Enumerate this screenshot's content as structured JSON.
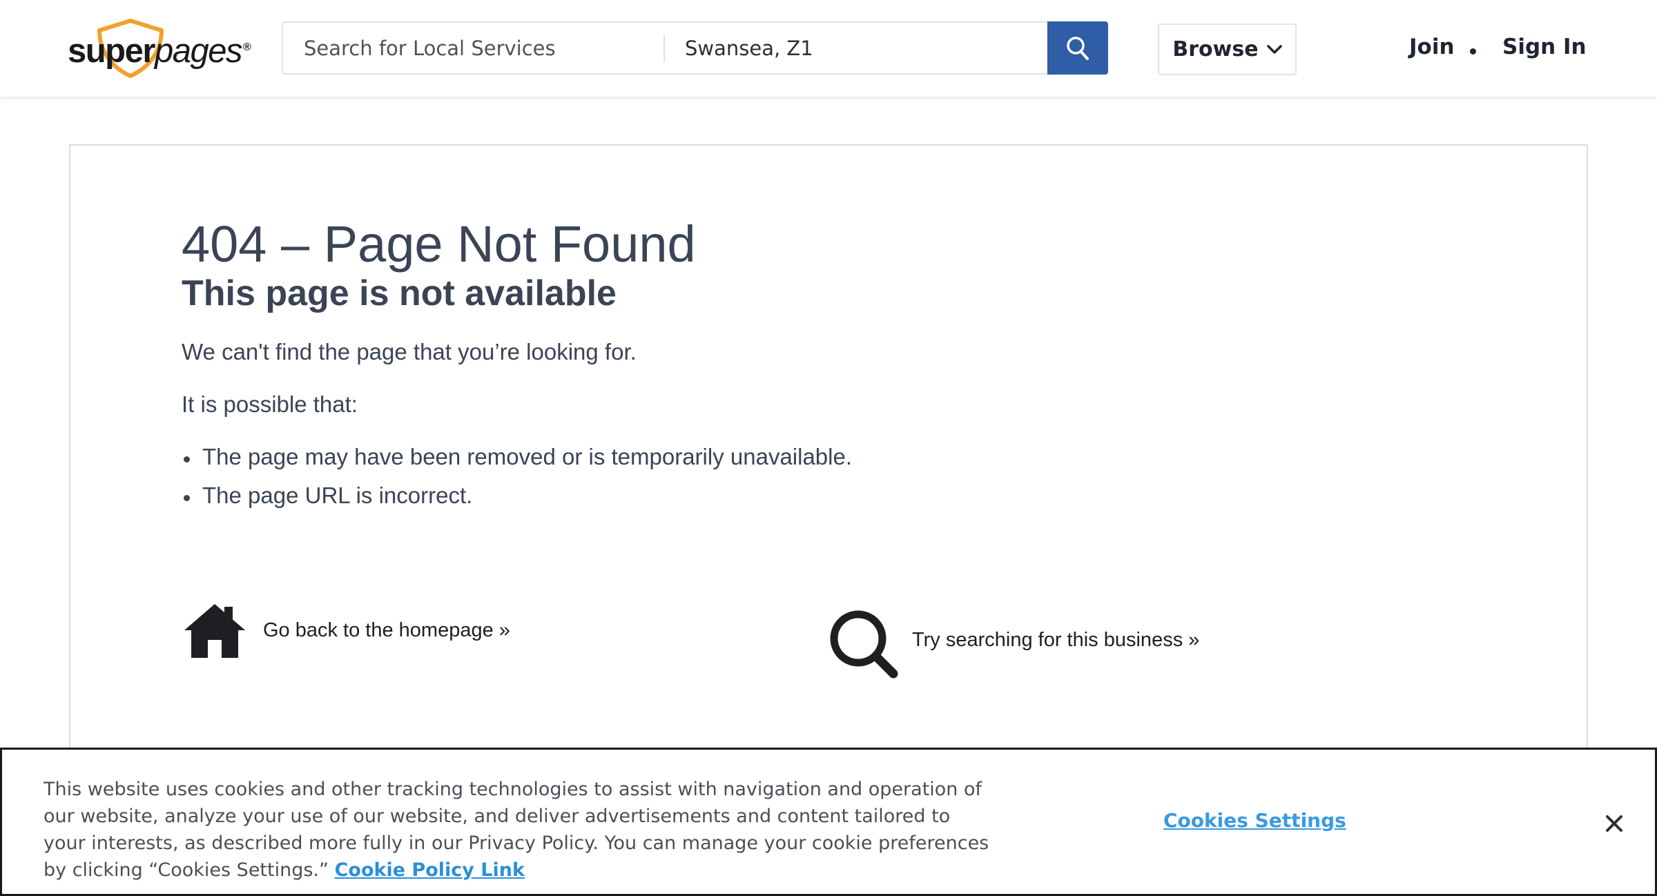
{
  "header": {
    "logo_text_bold": "super",
    "logo_text_light": "pages",
    "logo_reg": "®",
    "search": {
      "placeholder": "Search for Local Services",
      "value": ""
    },
    "location": {
      "value": "Swansea, Z1"
    },
    "browse_label": "Browse",
    "join_label": "Join",
    "signin_label": "Sign In"
  },
  "error": {
    "title": "404 – Page Not Found",
    "subtitle": "This page is not available",
    "message": "We can't find the page that you’re looking for.",
    "possible_intro": "It is possible that:",
    "reasons": [
      "The page may have been removed or is temporarily unavailable.",
      "The page URL is incorrect."
    ],
    "home_link": "Go back to the homepage »",
    "search_link": "Try searching for this business »"
  },
  "cookie_banner": {
    "text": "This website uses cookies and other tracking technologies to assist with navigation and operation of our website, analyze your use of our website, and deliver advertisements and content tailored to your interests, as described more fully in our Privacy Policy.  You can manage your cookie preferences by clicking “Cookies Settings.” ",
    "policy_link": "Cookie Policy Link",
    "settings_label": "Cookies Settings"
  },
  "colors": {
    "brand_orange": "#f2a031",
    "search_button": "#2f5ea6",
    "text_dark": "#3a4455",
    "link_blue": "#2c8fd8"
  },
  "icons": [
    "search-icon",
    "chevron-down-icon",
    "home-icon",
    "magnifier-icon",
    "close-icon"
  ]
}
